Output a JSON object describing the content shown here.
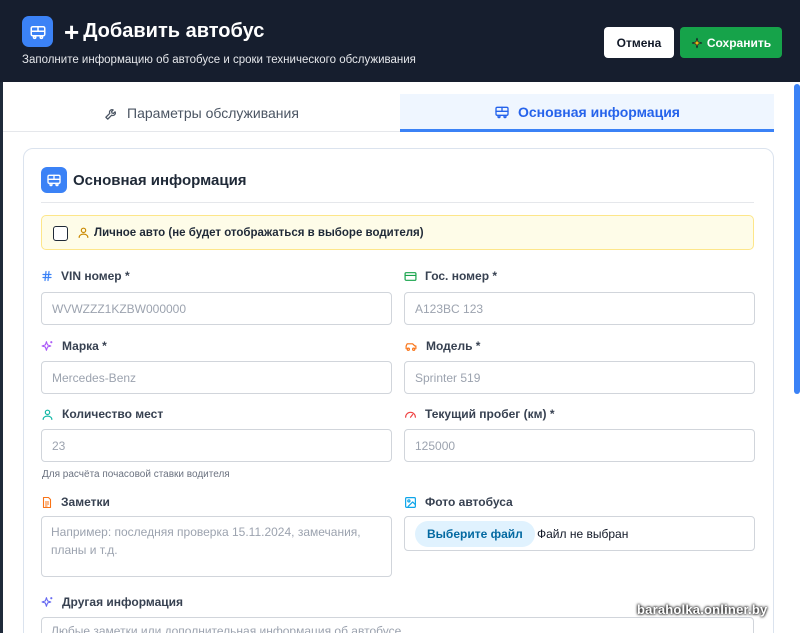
{
  "header": {
    "title": "Добавить автобус",
    "subtitle": "Заполните информацию об автобусе и сроки технического обслуживания",
    "cancel_label": "Отмена",
    "save_label": "Сохранить"
  },
  "tabs": [
    {
      "label": "Параметры обслуживания",
      "icon": "wrench-icon",
      "active": false
    },
    {
      "label": "Основная информация",
      "icon": "bus-icon",
      "active": true
    }
  ],
  "card": {
    "title": "Основная информация",
    "private_label": "Личное авто (не будет отображаться в выборе водителя)",
    "private_checked": false
  },
  "fields": {
    "vin": {
      "label": "VIN номер *",
      "placeholder": "WVWZZZ1KZBW000000"
    },
    "plate": {
      "label": "Гос. номер *",
      "placeholder": "A123BC 123"
    },
    "brand": {
      "label": "Марка *",
      "placeholder": "Mercedes-Benz"
    },
    "model": {
      "label": "Модель *",
      "placeholder": "Sprinter 519"
    },
    "seats": {
      "label": "Количество мест",
      "placeholder": "23",
      "hint": "Для расчёта почасовой ставки водителя"
    },
    "mileage": {
      "label": "Текущий пробег (км) *",
      "placeholder": "125000"
    },
    "notes": {
      "label": "Заметки",
      "placeholder": "Например: последняя проверка 15.11.2024, замечания, планы и т.д."
    },
    "photo": {
      "label": "Фото автобуса",
      "button": "Выберите файл",
      "status": "Файл не выбран"
    },
    "other": {
      "label": "Другая информация",
      "placeholder": "Любые заметки или дополнительная информация об автобусе"
    }
  },
  "watermark": "baraholka.onliner.by",
  "colors": {
    "header_bg": "#161e2e",
    "accent": "#3b82f6",
    "save": "#16a34a",
    "active_tab_bg": "#eff6ff",
    "private_bg": "#fefce8"
  }
}
